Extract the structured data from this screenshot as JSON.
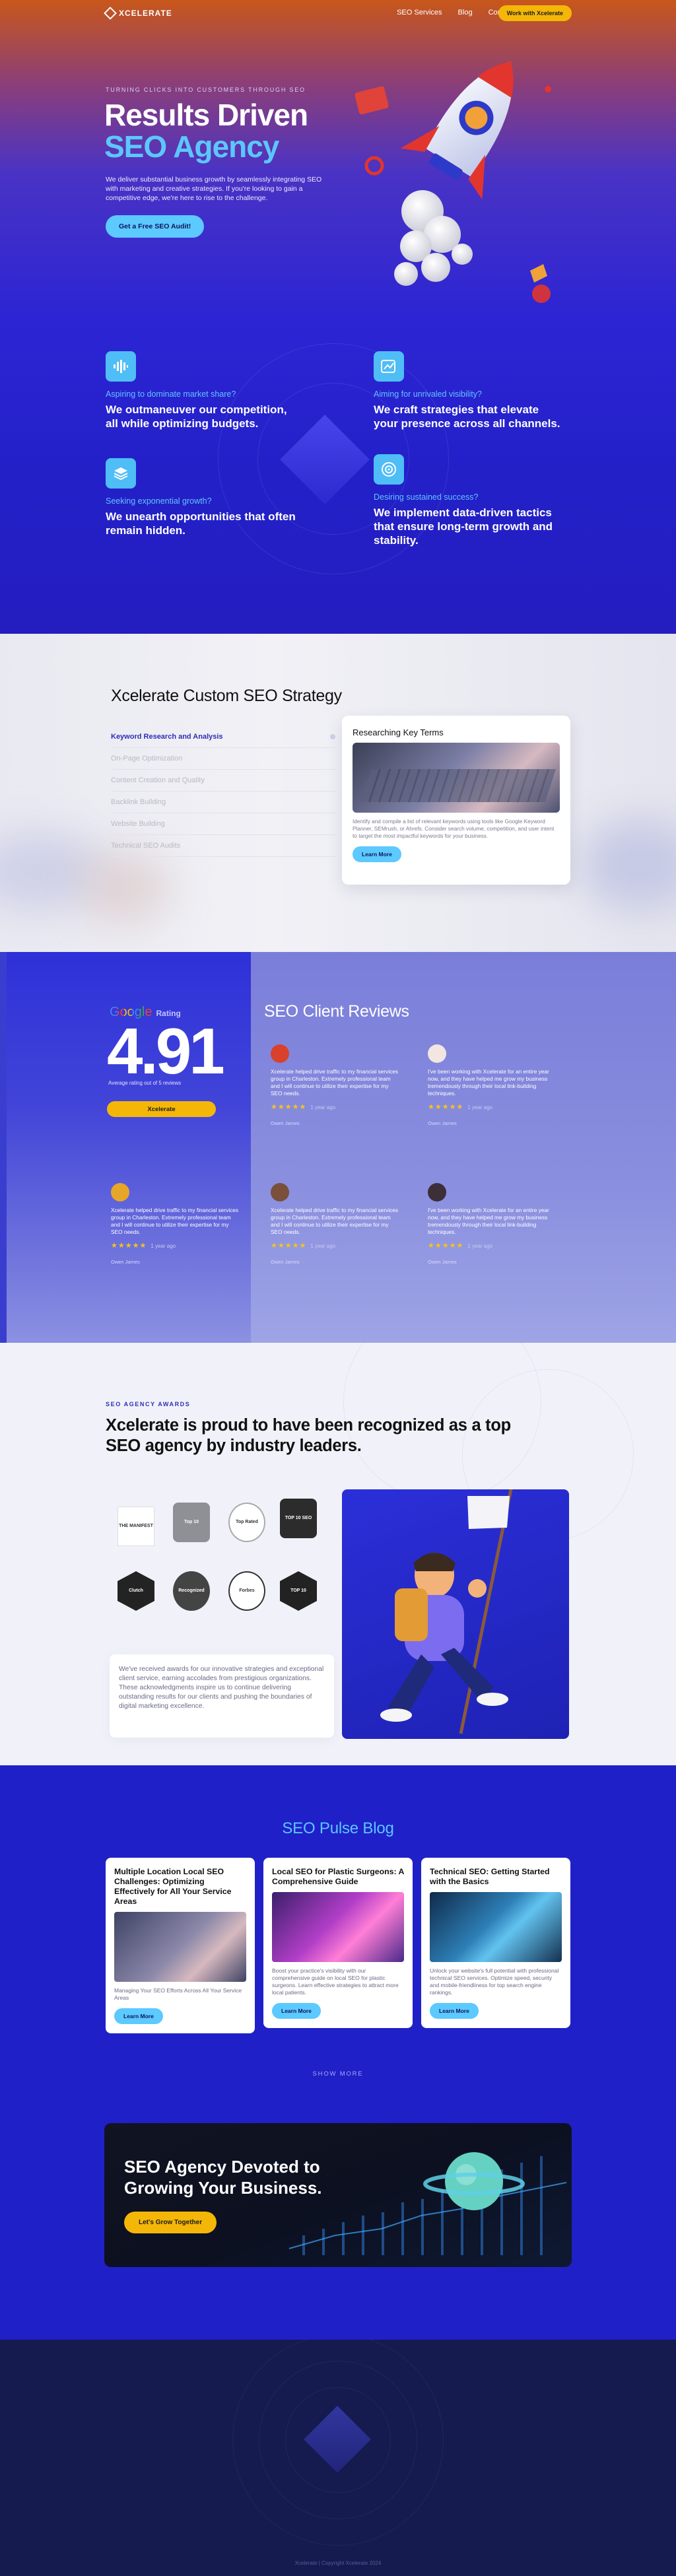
{
  "nav": {
    "logo": "XCELERATE",
    "links": [
      "SEO Services",
      "Blog",
      "Contact Us"
    ],
    "cta": "Work with Xcelerate"
  },
  "hero": {
    "eyebrow": "TURNING CLICKS INTO CUSTOMERS THROUGH SEO",
    "title_line1": "Results Driven",
    "title_line2": "SEO Agency",
    "description": "We deliver substantial business growth by seamlessly integrating SEO with marketing and creative strategies. If you're looking to gain a competitive edge, we're here to rise to the challenge.",
    "cta": "Get a Free SEO Audit!"
  },
  "features": [
    {
      "question": "Aspiring to dominate market share?",
      "answer": "We outmaneuver our competition, all while optimizing budgets.",
      "icon": "bar-waves-icon"
    },
    {
      "question": "Aiming for unrivaled visibility?",
      "answer": "We craft strategies that elevate your presence across all channels.",
      "icon": "image-growth-icon"
    },
    {
      "question": "Seeking exponential growth?",
      "answer": "We unearth opportunities that often remain hidden.",
      "icon": "stack-layers-icon"
    },
    {
      "question": "Desiring sustained success?",
      "answer": "We implement data-driven tactics that ensure long-term growth and stability.",
      "icon": "target-icon"
    }
  ],
  "strategy": {
    "title": "Xcelerate Custom SEO Strategy",
    "tabs": [
      "Keyword Research and Analysis",
      "On-Page Optimization",
      "Content Creation and Quality",
      "Backlink Building",
      "Website Building",
      "Technical SEO Audits"
    ],
    "card_title": "Researching Key Terms",
    "card_text": "Identify and compile a list of relevant keywords using tools like Google Keyword Planner, SEMrush, or Ahrefs. Consider search volume, competition, and user intent to target the most impactful keywords for your business.",
    "card_button": "Learn More"
  },
  "reviews": {
    "google": "Google",
    "rating_label": "Rating",
    "score": "4.91",
    "average": "Average rating out of 5 reviews",
    "button": "Xcelerate",
    "title": "SEO Client Reviews",
    "items": [
      {
        "text": "Xcelerate helped drive traffic to my financial services group in Charleston. Extremely professional team and I will continue to utilize their expertise for my SEO needs.",
        "stars": "★★★★★",
        "ago": "1 year ago",
        "name": "Owen James",
        "color": "#d9412b"
      },
      {
        "text": "I've been working with Xcelerate for an entire year now, and they have helped me grow my business tremendously through their local link-building techniques.",
        "stars": "★★★★★",
        "ago": "1 year ago",
        "name": "Owen James",
        "color": "#c77a6c"
      },
      {
        "text": "Xcelerate helped drive traffic to my financial services group in Charleston. Extremely professional team and I will continue to utilize their expertise for my SEO needs.",
        "stars": "★★★★★",
        "ago": "1 year ago",
        "name": "Owen James",
        "color": "#e6a62a"
      },
      {
        "text": "Xcelerate helped drive traffic to my financial services group in Charleston. Extremely professional team and I will continue to utilize their expertise for my SEO needs.",
        "stars": "★★★★★",
        "ago": "1 year ago",
        "name": "Owen James",
        "color": "#7a4f3c"
      },
      {
        "text": "I've been working with Xcelerate for an entire year now, and they have helped me grow my business tremendously through their local link-building techniques.",
        "stars": "★★★★★",
        "ago": "1 year ago",
        "name": "Owen James",
        "color": "#3c2f37"
      }
    ]
  },
  "awards": {
    "eyebrow": "SEO AGENCY AWARDS",
    "title": "Xcelerate is proud to have been recognized as a top SEO agency by industry leaders.",
    "badges": [
      "THE MANIFEST",
      "Top 10",
      "Top Rated",
      "TOP 10 SEO",
      "Clutch",
      "Recognized",
      "Forbes",
      "TOP 10"
    ],
    "text": "We've received awards for our innovative strategies and exceptional client service, earning accolades from prestigious organizations. These acknowledgments inspire us to continue delivering outstanding results for our clients and pushing the boundaries of digital marketing excellence."
  },
  "blog": {
    "title": "SEO Pulse Blog",
    "posts": [
      {
        "title": "Multiple Location Local SEO Challenges: Optimizing Effectively for All Your Service Areas",
        "text": "Managing Your SEO Efforts Across All Your Service Areas",
        "button": "Learn More"
      },
      {
        "title": "Local SEO for Plastic Surgeons: A Comprehensive Guide",
        "text": "Boost your practice's visibility with our comprehensive guide on local SEO for plastic surgeons. Learn effective strategies to attract more local patients.",
        "button": "Learn More"
      },
      {
        "title": "Technical SEO: Getting Started with the Basics",
        "text": "Unlock your website's full potential with professional technical SEO services. Optimize speed, security and mobile-friendliness for top search engine rankings.",
        "button": "Learn More"
      }
    ],
    "show_more": "SHOW MORE",
    "banner_title_1": "SEO Agency Devoted to",
    "banner_title_2": "Growing Your Business.",
    "banner_button": "Let's Grow Together"
  },
  "footer": {
    "copyright": "Xcelerate | Copyright Xcelerate 2024"
  }
}
